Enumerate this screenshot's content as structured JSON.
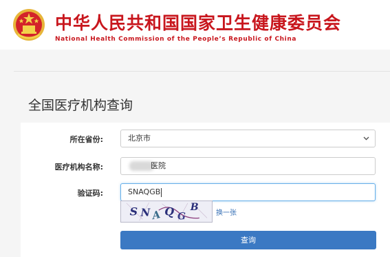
{
  "header": {
    "title_cn": "中华人民共和国国家卫生健康委员会",
    "title_en": "National Health Commission of the People’s Republic of China",
    "emblem_icon": "national-emblem-icon",
    "brand_color": "#c8161d"
  },
  "page": {
    "title": "全国医疗机构查询"
  },
  "form": {
    "province": {
      "label": "所在省份:",
      "value": "北京市"
    },
    "institution_name": {
      "label": "医疗机构名称:",
      "value_visible": "医院"
    },
    "captcha": {
      "label": "验证码:",
      "input_value": "SNAQGB",
      "image_text": "SNAQGB",
      "refresh_label": "换一张"
    },
    "submit_label": "查询",
    "accent_color": "#3b79c3"
  }
}
